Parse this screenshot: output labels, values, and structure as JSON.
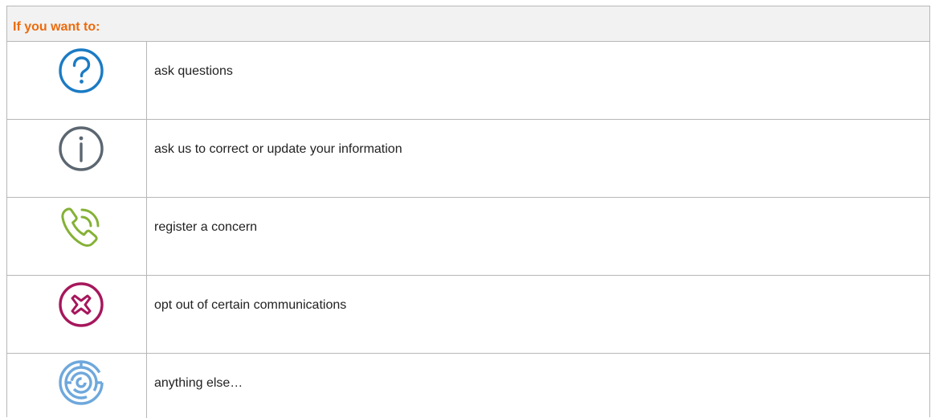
{
  "header": {
    "title": "If you want to:"
  },
  "colors": {
    "header_text": "#ec6b0c",
    "question_icon": "#1b7bc4",
    "info_icon": "#5b6670",
    "phone_icon": "#84b135",
    "optout_icon": "#a6175c",
    "maze_icon": "#6ea8dc"
  },
  "rows": [
    {
      "icon": "question-mark-circle-icon",
      "label": "ask questions"
    },
    {
      "icon": "info-circle-icon",
      "label": "ask us to correct or update your information"
    },
    {
      "icon": "phone-ringing-icon",
      "label": "register a concern"
    },
    {
      "icon": "x-circle-icon",
      "label": "opt out of certain communications"
    },
    {
      "icon": "maze-icon",
      "label": "anything else…"
    }
  ]
}
